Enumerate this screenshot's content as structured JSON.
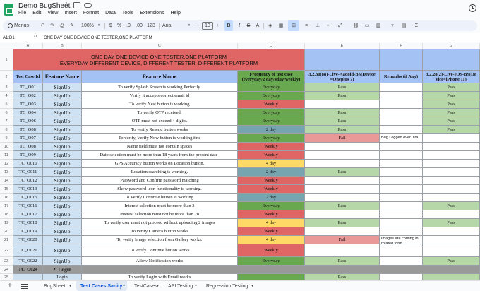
{
  "title_bar": {
    "doc_title": "Demo BugSheet"
  },
  "menu": [
    "File",
    "Edit",
    "View",
    "Insert",
    "Format",
    "Data",
    "Tools",
    "Extensions",
    "Help"
  ],
  "toolbar": {
    "menus": "Menus",
    "zoom": "100%",
    "currency": "$",
    "percent": "%",
    "decimal_less": ".0",
    "decimal_more": ".00",
    "number_format": "123",
    "font": "Arial",
    "font_size": "13",
    "bold": "B",
    "italic": "I",
    "strike": "S",
    "text_color": "A"
  },
  "formula_bar": {
    "cell_ref": "A1:D1",
    "fx": "fx",
    "content": "ONE DAY ONE DEVICE ONE TESTER,ONE PLATFORM"
  },
  "columns": [
    "A",
    "B",
    "C",
    "D",
    "E",
    "F",
    "G"
  ],
  "rows": [
    "1",
    "2",
    "3",
    "4",
    "5",
    "6",
    "7",
    "8",
    "9",
    "10",
    "11",
    "12",
    "13",
    "14",
    "15",
    "16",
    "17",
    "18",
    "19",
    "20",
    "21",
    "22",
    "23",
    "24",
    "25"
  ],
  "banner": {
    "line1": "ONE DAY ONE DEVICE ONE TESTER,ONE PLATFORM",
    "line2": "EVERYDAY DIFFERENT DEVICE, DIFFERENT TESTER, DIFFERENT PLATFORM"
  },
  "headers": {
    "id": "Test Case Id",
    "module": "Feature Name",
    "feature": "Feature Name",
    "frequency": "Frequency of test case (everyday/2 day/4day/weekly)",
    "android": "3.2.30(88)-Live-Aadoid-BS(Device =Oneplus 7)",
    "remarks": "Remarks (if Any)",
    "ios": "3.2.28(2)-Live-IOS-BS(De vice=iPhone 11)"
  },
  "test_cases": [
    {
      "id": "TC_O01",
      "module": "SignUp",
      "feature": "To verify Splash Screen is working Perfectly.",
      "frequency": "Everyday",
      "android": "Pass",
      "remarks": "",
      "ios": "Pass"
    },
    {
      "id": "TC_O02",
      "module": "SignUp",
      "feature": "Verify it accepts correct email id",
      "frequency": "Everyday",
      "android": "Pass",
      "remarks": "",
      "ios": "Pass"
    },
    {
      "id": "TC_O03",
      "module": "SignUp",
      "feature": "To verify Nest button is working",
      "frequency": "Weekly",
      "android": "",
      "remarks": "",
      "ios": "Pass"
    },
    {
      "id": "TC_O04",
      "module": "SignUp",
      "feature": "To verify OTP received.",
      "frequency": "Everyday",
      "android": "Pass",
      "remarks": "",
      "ios": "Pass"
    },
    {
      "id": "TC_O06",
      "module": "SignUp",
      "feature": "OTP must not exceed 4 digits.",
      "frequency": "Everyday",
      "android": "Pass",
      "remarks": "",
      "ios": "Pass"
    },
    {
      "id": "TC_O08",
      "module": "SignUp",
      "feature": "To verify Resend button works",
      "frequency": "2 day",
      "android": "Pass",
      "remarks": "",
      "ios": "Pass"
    },
    {
      "id": "TC_O07",
      "module": "SignUp",
      "feature": "To verify, Verify Now button is working fine",
      "frequency": "Everyday",
      "android": "Fail",
      "remarks": "Bug Logged over Jira",
      "ios": ""
    },
    {
      "id": "TC_O08",
      "module": "SignUp",
      "feature": "Name field must not contain spaces",
      "frequency": "Weekly",
      "android": "",
      "remarks": "",
      "ios": ""
    },
    {
      "id": "TC_O09",
      "module": "SignUp",
      "feature": "Date selection must be more than 18 years from the present date-",
      "frequency": "Weekly",
      "android": "",
      "remarks": "",
      "ios": ""
    },
    {
      "id": "TC_O010",
      "module": "SignUp",
      "feature": "GPS Accuracy button works on Location button.",
      "frequency": "4 day",
      "android": "",
      "remarks": "",
      "ios": ""
    },
    {
      "id": "TC_O011",
      "module": "SignUp",
      "feature": "Location searching is working.",
      "frequency": "2 day",
      "android": "Pass",
      "remarks": "",
      "ios": ""
    },
    {
      "id": "TC_O012",
      "module": "SignUp",
      "feature": "Password and Confirm password matching",
      "frequency": "Weekly",
      "android": "",
      "remarks": "",
      "ios": ""
    },
    {
      "id": "TC_O013",
      "module": "SignUp",
      "feature": "Show password icon functionality is working.",
      "frequency": "Weekly",
      "android": "",
      "remarks": "",
      "ios": ""
    },
    {
      "id": "TC_O015",
      "module": "SignUp",
      "feature": "To Verify Continue button is working.",
      "frequency": "2 day",
      "android": "",
      "remarks": "",
      "ios": ""
    },
    {
      "id": "TC_O016",
      "module": "SignUp",
      "feature": "Interest selection must be more than 3",
      "frequency": "Everyday",
      "android": "Pass",
      "remarks": "",
      "ios": "Pass"
    },
    {
      "id": "TC_O017",
      "module": "SignUp",
      "feature": "Interest selection must not be more than 20",
      "frequency": "Weekly",
      "android": "",
      "remarks": "",
      "ios": ""
    },
    {
      "id": "TC_O018",
      "module": "SignUp",
      "feature": "To verify user must not proceed without uploading 2 images",
      "frequency": "4 day",
      "android": "Pass",
      "remarks": "",
      "ios": "Pass"
    },
    {
      "id": "TC_O019",
      "module": "SignUp",
      "feature": "To verify Camera button works",
      "frequency": "Weekly",
      "android": "",
      "remarks": "",
      "ios": ""
    },
    {
      "id": "TC_O020",
      "module": "SignUp",
      "feature": "To verify Image selection from Gallery works.",
      "frequency": "4 day",
      "android": "Fail",
      "remarks": "Images are coming in rotated form",
      "ios": ""
    },
    {
      "id": "TC_O021",
      "module": "SignUp",
      "feature": "To verify Continue button works",
      "frequency": "Weekly",
      "android": "",
      "remarks": "",
      "ios": ""
    },
    {
      "id": "TC_O022",
      "module": "SignUp",
      "feature": "Allow Notification works",
      "frequency": "Everyday",
      "android": "Pass",
      "remarks": "",
      "ios": "Pass"
    }
  ],
  "section_row": {
    "id": "TC_O024",
    "module": "2. Login"
  },
  "last_row": {
    "module": "Login",
    "feature": "To verify Login with Email works",
    "android": "Pass"
  },
  "sheet_tabs": [
    "BugSheet",
    "Test Cases Sanity",
    "TestCases",
    "API Testing",
    "Regression Testing"
  ],
  "active_tab": "Test Cases Sanity",
  "colors": {
    "banner": "#e06666",
    "header_blue": "#a4c2f4",
    "header_green": "#6aa84f",
    "id_col": "#cfe2f3",
    "everyday": "#6aa84f",
    "weekly": "#e06666",
    "two_day": "#76a5af",
    "four_day": "#ffd966",
    "pass": "#b6d7a8",
    "fail": "#ea9999",
    "section": "#999999"
  }
}
